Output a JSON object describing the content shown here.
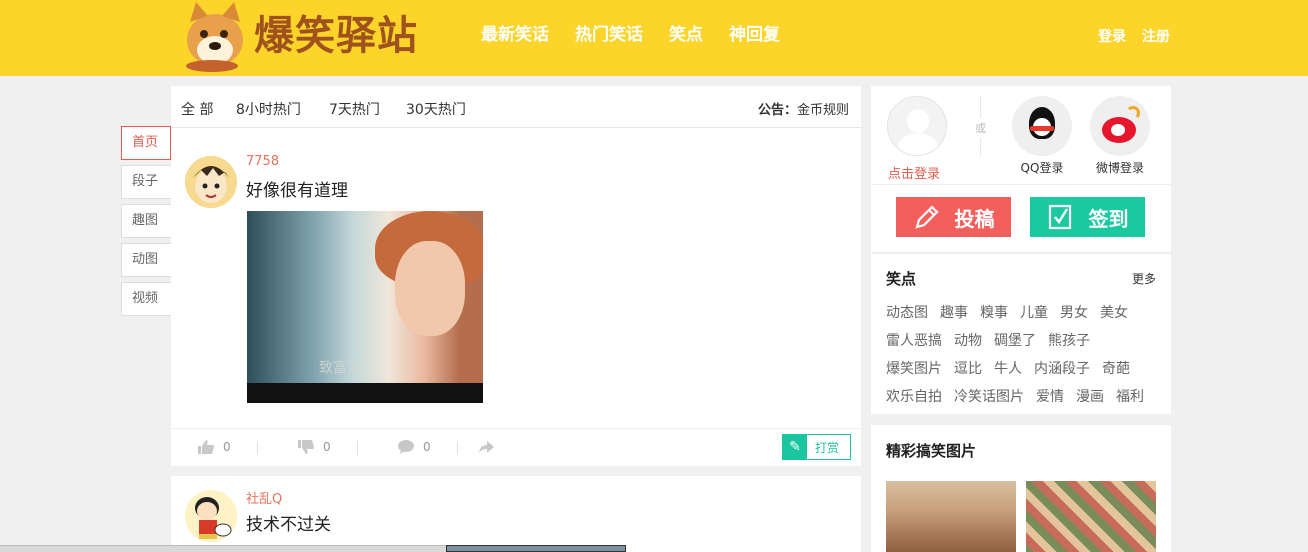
{
  "header": {
    "logo_text": "爆笑驿站",
    "nav": [
      "最新笑话",
      "热门笑话",
      "笑点",
      "神回复"
    ],
    "login": "登录",
    "register": "注册"
  },
  "sidemenu": {
    "items": [
      "首页",
      "段子",
      "趣图",
      "动图",
      "视频"
    ],
    "active": "首页"
  },
  "tabs": {
    "items": [
      "全 部",
      "8小时热门",
      "7天热门",
      "30天热门"
    ],
    "notice_label": "公告：",
    "notice_link": "金币规则"
  },
  "posts": [
    {
      "username": "7758",
      "title": "好像很有道理",
      "image_caption": "致富宝",
      "likes": "0",
      "dislikes": "0",
      "comments": "0",
      "tip_label": "打赏"
    },
    {
      "username": "社乱Q",
      "title": "技术不过关"
    }
  ],
  "right": {
    "click_login": "点击登录",
    "or": "或",
    "qq_login": "QQ登录",
    "weibo_login": "微博登录",
    "submit_button": "投稿",
    "checkin_button": "签到",
    "tags_title": "笑点",
    "tags_more": "更多",
    "tags": [
      [
        "动态图",
        "趣事",
        "糗事",
        "儿童",
        "男女",
        "美女"
      ],
      [
        "雷人恶搞",
        "动物",
        "碉堡了",
        "熊孩子"
      ],
      [
        "爆笑图片",
        "逗比",
        "牛人",
        "内涵段子",
        "奇葩"
      ],
      [
        "欢乐自拍",
        "冷笑话图片",
        "爱情",
        "漫画",
        "福利"
      ]
    ],
    "pics_title": "精彩搞笑图片"
  },
  "colors": {
    "header_bg": "#fdd42a",
    "accent_red": "#e85a4f",
    "accent_green": "#1bc9a0"
  }
}
